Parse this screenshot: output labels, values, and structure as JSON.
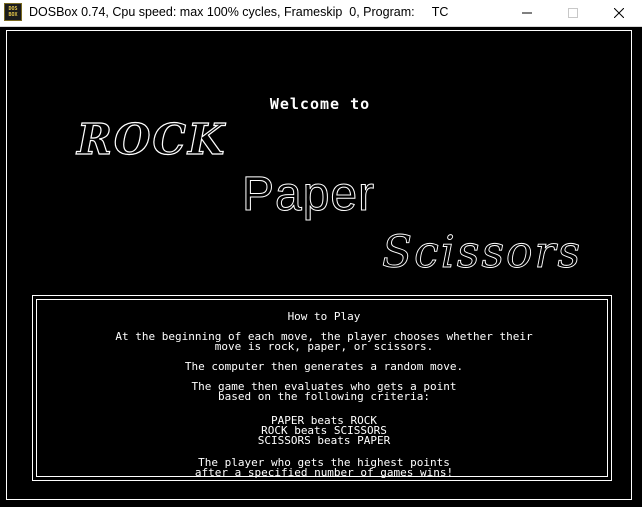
{
  "window": {
    "title": "DOSBox 0.74, Cpu speed: max 100% cycles, Frameskip  0, Program:     TC",
    "icon_text": "DOS BOX",
    "icons": {
      "minimize": "minimize-icon",
      "maximize": "maximize-icon",
      "close": "close-icon"
    }
  },
  "game": {
    "welcome": "Welcome to",
    "rock": "ROCK",
    "paper": "Paper",
    "scissors": "Scissors"
  },
  "how_to_play": {
    "heading": "How to Play",
    "paragraph1": "At the beginning of each move, the player chooses whether their\nmove is rock, paper, or scissors.",
    "paragraph2": "The computer then generates a random move.",
    "paragraph3": "The game then evaluates who gets a point\nbased on the following criteria:",
    "rules": "PAPER beats ROCK\nROCK beats SCISSORS\nSCISSORS beats PAPER",
    "paragraph4": "The player who gets the highest points\nafter a specified number of games wins!"
  },
  "colors": {
    "background": "#000000",
    "foreground": "#ffffff",
    "titlebar": "#ffffff"
  }
}
